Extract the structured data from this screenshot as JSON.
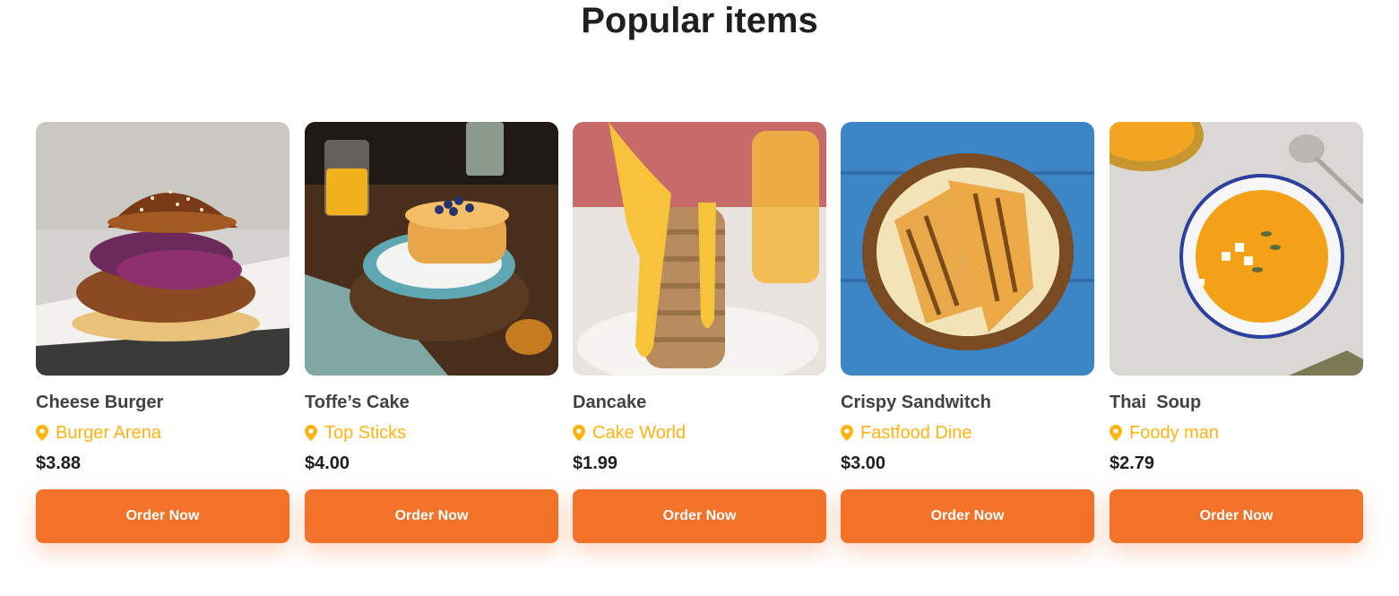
{
  "section": {
    "title": "Popular items"
  },
  "colors": {
    "accent": "#f17228",
    "restaurant": "#ffb30e",
    "name": "#424242",
    "price": "#1f1f1f"
  },
  "items": [
    {
      "name": "Cheese Burger",
      "restaurant": "Burger Arena",
      "price": "$3.88",
      "button": "Order Now",
      "image": "cheese-burger-photo"
    },
    {
      "name": "Toffe’s Cake",
      "restaurant": "Top Sticks",
      "price": "$4.00",
      "button": "Order Now",
      "image": "pancake-stack-photo"
    },
    {
      "name": "Dancake",
      "restaurant": "Cake World",
      "price": "$1.99",
      "button": "Order Now",
      "image": "dancake-photo"
    },
    {
      "name": "Crispy Sandwitch",
      "restaurant": "Fastfood Dine",
      "price": "$3.00",
      "button": "Order Now",
      "image": "sandwich-photo"
    },
    {
      "name": "Thai  Soup",
      "restaurant": "Foody man",
      "price": "$2.79",
      "button": "Order Now",
      "image": "soup-photo"
    }
  ]
}
